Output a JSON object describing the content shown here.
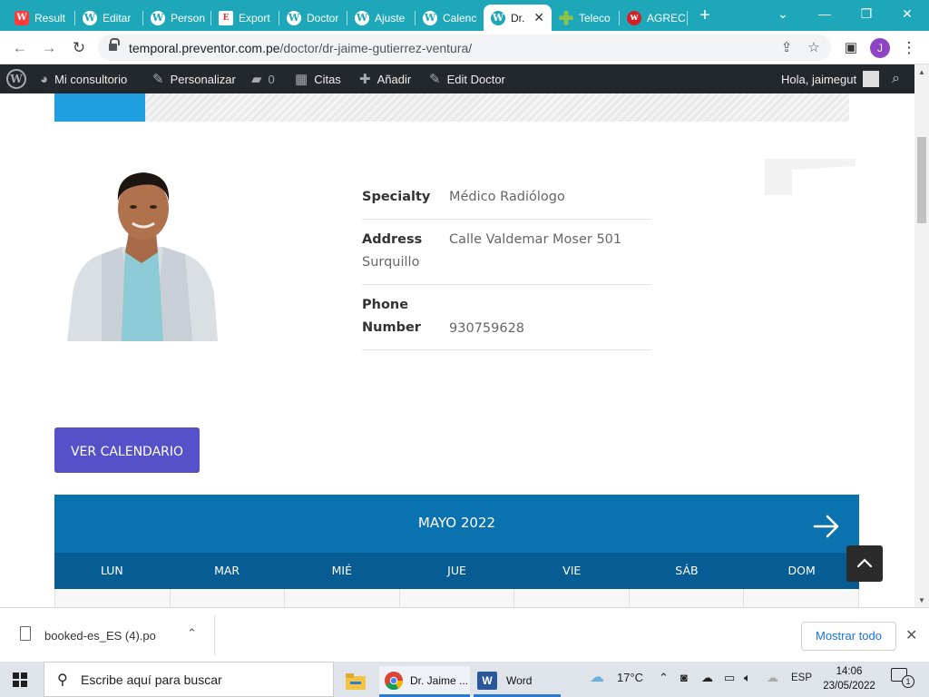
{
  "browser": {
    "tabs": [
      {
        "label": "Result",
        "icon": "ae"
      },
      {
        "label": "Editar",
        "icon": "wp"
      },
      {
        "label": "Person",
        "icon": "wp"
      },
      {
        "label": "Export",
        "icon": "ex"
      },
      {
        "label": "Doctor",
        "icon": "wp"
      },
      {
        "label": "Ajuste",
        "icon": "wp"
      },
      {
        "label": "Calenc",
        "icon": "wp"
      },
      {
        "label": "Dr.",
        "icon": "wp"
      },
      {
        "label": "Teleco",
        "icon": "pl"
      },
      {
        "label": "AGREC",
        "icon": "ag"
      }
    ],
    "url_host": "temporal.preventor.com.pe",
    "url_path": "/doctor/dr-jaime-gutierrez-ventura/",
    "profile_initial": "J"
  },
  "wp_admin": {
    "my_site": "Mi consultorio",
    "customize": "Personalizar",
    "comments_count": "0",
    "appointments": "Citas",
    "add_new": "Añadir",
    "edit": "Edit Doctor",
    "greeting": "Hola, jaimegut"
  },
  "doctor": {
    "specialty_label": "Specialty",
    "specialty_value": "Médico Radiólogo",
    "address_label": "Address",
    "address_value_1": "Calle Valdemar Moser 501",
    "address_value_2": "Surquillo",
    "phone_label_1": "Phone",
    "phone_label_2": "Number",
    "phone_value": "930759628"
  },
  "calendar_button": "VER CALENDARIO",
  "calendar": {
    "month": "MAYO 2022",
    "days": [
      "LUN",
      "MAR",
      "MIÉ",
      "JUE",
      "VIE",
      "SÁB",
      "DOM"
    ]
  },
  "downloads": {
    "file": "booked-es_ES (4).po",
    "show_all": "Mostrar todo"
  },
  "taskbar": {
    "search_placeholder": "Escribe aquí para buscar",
    "chrome_label": "Dr. Jaime ...",
    "word_label": "Word",
    "weather": "17°C",
    "language": "ESP",
    "time": "14:06",
    "date": "23/05/2022",
    "notifications": "1"
  },
  "colors": {
    "tabbar": "#1ea7b9",
    "wp_bar": "#23282d",
    "button": "#5451c9",
    "calendar_header": "#0b72b0",
    "calendar_days": "#075c93"
  }
}
